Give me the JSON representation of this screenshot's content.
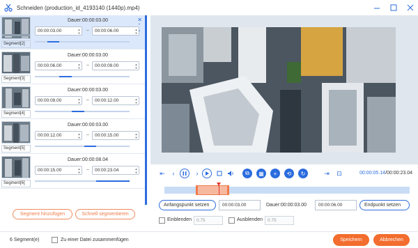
{
  "window": {
    "title": "Schneiden (production_id_4193140 (1440p).mp4)",
    "app_icon": "scissors-icon",
    "controls": [
      "minimize-icon",
      "maximize-icon",
      "close-icon"
    ]
  },
  "segments": [
    {
      "label": "Segment[2]",
      "duration": "Dauer:00:00:03.00",
      "start": "00:00:03.00",
      "end": "00:00:06.00",
      "active": true,
      "progress": 0.13
    },
    {
      "label": "Segment[3]",
      "duration": "Dauer:00:00:03.00",
      "start": "00:00:06.00",
      "end": "00:00:09.00",
      "active": false,
      "progress": 0.26
    },
    {
      "label": "Segment[4]",
      "duration": "Dauer:00:00:03.00",
      "start": "00:00:09.00",
      "end": "00:00:12.00",
      "active": false,
      "progress": 0.39
    },
    {
      "label": "Segment[5]",
      "duration": "Dauer:00:00:03.00",
      "start": "00:00:12.00",
      "end": "00:00:15.00",
      "active": false,
      "progress": 0.52
    },
    {
      "label": "Segment[6]",
      "duration": "Dauer:00:00:08.04",
      "start": "00:00:15.00",
      "end": "00:00:23.04",
      "active": false,
      "progress": 0.65
    }
  ],
  "segment_separator": "–",
  "left_buttons": {
    "add_segment": "Segment hinzufügen",
    "quick_split": "Schnell segmentieren"
  },
  "player": {
    "current_time": "00:00:05.14",
    "total_time": "/00:00:23.04",
    "icons": [
      "jump-start-icon",
      "prev-frame-icon",
      "pause-icon",
      "next-frame-icon",
      "stop-icon",
      "volume-icon",
      "copy-icon",
      "split-icon",
      "add-icon",
      "rotate-icon",
      "refresh-icon",
      "jump-to-start-marker-icon",
      "jump-to-end-marker-icon"
    ]
  },
  "timeline": {
    "selection_start": 0.13,
    "selection_end": 0.26,
    "playhead": 0.223
  },
  "cut": {
    "set_start": "Anfangspunkt setzen",
    "start": "00:00:03.00",
    "duration": "Dauer:00:00:03.00",
    "end": "00:00:06.00",
    "set_end": "Endpunkt setzen"
  },
  "fades": {
    "fade_in_label": "Einblenden",
    "fade_in_value": "0.75",
    "fade_out_label": "Ausblenden",
    "fade_out_value": "0.75"
  },
  "bottom": {
    "segment_count": "6 Segment(e)",
    "merge_label": "Zu einer Datei zusammenfügen",
    "save": "Speichern",
    "cancel": "Abbrechen"
  },
  "colors": {
    "accent": "#2b6cde",
    "orange": "#f36d2e",
    "selection": "#f6b9a0"
  }
}
